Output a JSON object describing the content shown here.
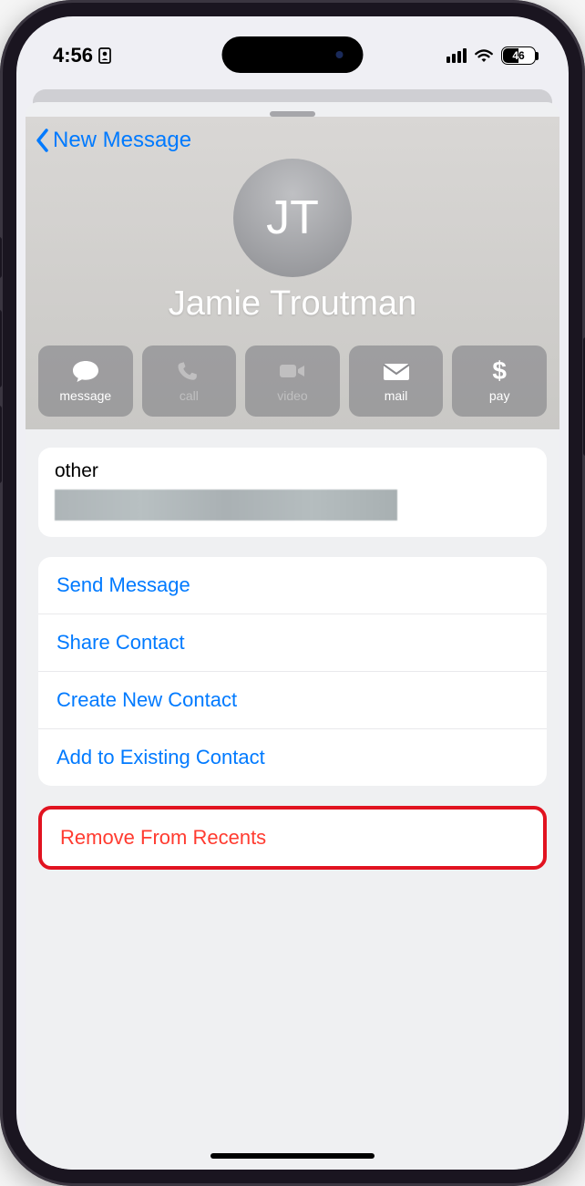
{
  "status": {
    "time": "4:56",
    "battery_text": "46"
  },
  "nav": {
    "back_label": "New Message"
  },
  "contact": {
    "initials": "JT",
    "name": "Jamie Troutman"
  },
  "actions": {
    "message": "message",
    "call": "call",
    "video": "video",
    "mail": "mail",
    "pay": "pay"
  },
  "other": {
    "label": "other"
  },
  "options": {
    "send_message": "Send Message",
    "share_contact": "Share Contact",
    "create_new": "Create New Contact",
    "add_existing": "Add to Existing Contact"
  },
  "remove": {
    "label": "Remove From Recents"
  },
  "pay_symbol": "$"
}
